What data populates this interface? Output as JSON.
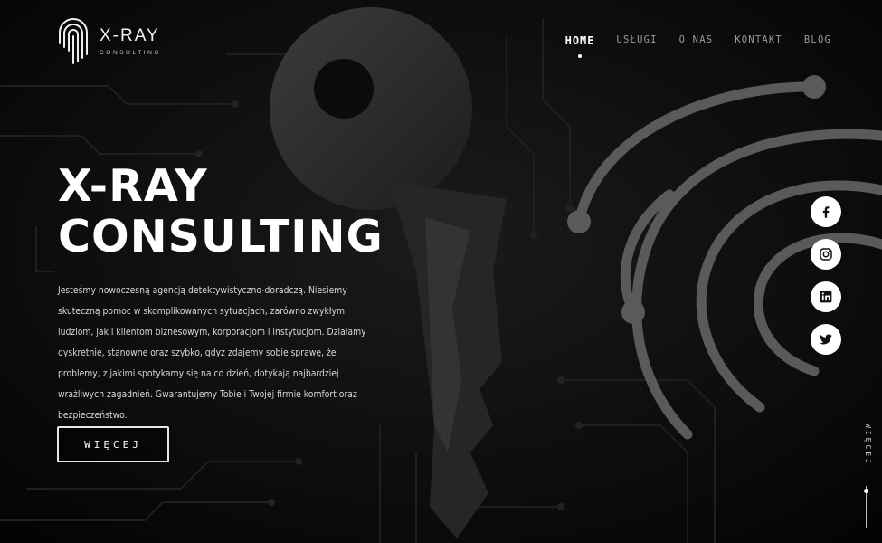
{
  "brand": {
    "name": "X-RAY",
    "sub": "CONSULTING"
  },
  "nav": [
    {
      "label": "HOME",
      "active": true
    },
    {
      "label": "USŁUGI",
      "active": false
    },
    {
      "label": "O NAS",
      "active": false
    },
    {
      "label": "KONTAKT",
      "active": false
    },
    {
      "label": "BLOG",
      "active": false
    }
  ],
  "hero": {
    "title_line1": "X-RAY",
    "title_line2": "CONSULTING",
    "text": "Jesteśmy nowoczesną agencją detektywistyczno-doradczą. Niesiemy skuteczną pomoc w skomplikowanych sytuacjach, zarówno zwykłym ludziom, jak i klientom biznesowym, korporacjom i instytucjom. Działamy dyskretnie, stanowne oraz szybko, gdyż zdajemy sobie sprawę, że problemy, z jakimi spotykamy się na co dzień, dotykają najbardziej wrażliwych zagadnień. Gwarantujemy Tobie i Twojej firmie komfort oraz bezpieczeństwo.",
    "button": "WIĘCEJ"
  },
  "social": [
    "facebook-icon",
    "instagram-icon",
    "linkedin-icon",
    "twitter-icon"
  ],
  "side_label": "WIĘCEJ",
  "colors": {
    "background": "#050505",
    "text": "#ffffff",
    "muted": "#9a9a9a"
  }
}
